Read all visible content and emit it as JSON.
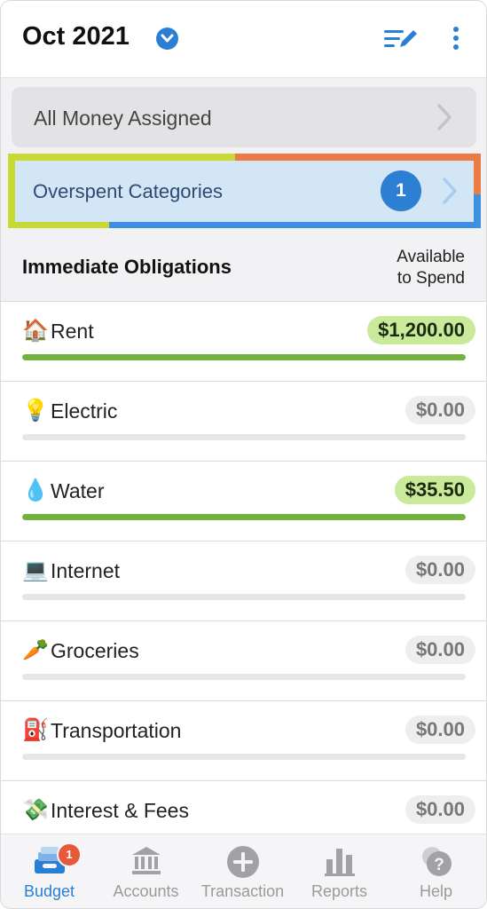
{
  "header": {
    "month": "Oct 2021"
  },
  "banners": {
    "assigned_label": "All Money Assigned",
    "overspent_label": "Overspent Categories",
    "overspent_count": "1"
  },
  "group": {
    "title": "Immediate Obligations",
    "available_line1": "Available",
    "available_line2": "to Spend"
  },
  "rows": [
    {
      "emoji": "🏠",
      "name": "Rent",
      "amount": "$1,200.00",
      "progress": 1.0
    },
    {
      "emoji": "💡",
      "name": "Electric",
      "amount": "$0.00",
      "progress": 0
    },
    {
      "emoji": "💧",
      "name": "Water",
      "amount": "$35.50",
      "progress": 1.0
    },
    {
      "emoji": "💻",
      "name": "Internet",
      "amount": "$0.00",
      "progress": 0
    },
    {
      "emoji": "🥕",
      "name": "Groceries",
      "amount": "$0.00",
      "progress": 0
    },
    {
      "emoji": "⛽",
      "name": "Transportation",
      "amount": "$0.00",
      "progress": 0
    },
    {
      "emoji": "💸",
      "name": "Interest & Fees",
      "amount": "$0.00",
      "progress": 0
    }
  ],
  "nav": {
    "budget": "Budget",
    "budget_badge": "1",
    "accounts": "Accounts",
    "transaction": "Transaction",
    "reports": "Reports",
    "help": "Help"
  },
  "colors": {
    "accent": "#2a7fd4",
    "positive_pill": "#c9ea9a",
    "progress": "#73b140",
    "badge": "#e65a3a"
  }
}
